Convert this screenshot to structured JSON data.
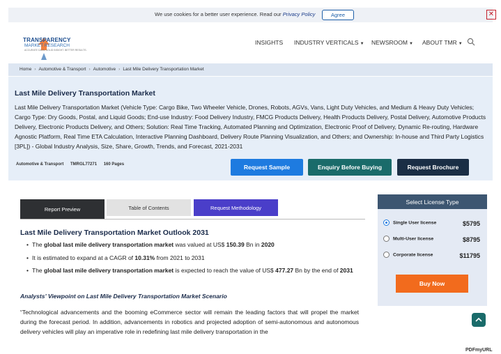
{
  "cookie": {
    "text": "We use cookies for a better user experience. Read our ",
    "link": "Privacy Policy",
    "agree": "Agree",
    "close": "✕"
  },
  "logo": {
    "main": "TRANSPARENCY",
    "sub": "MARKET RESEARCH",
    "tag": "ACCURATE DATA. SOLID INSIGHT. BETTER RESULTS."
  },
  "nav": [
    "INSIGHTS",
    "INDUSTRY VERTICALS",
    "NEWSROOM",
    "ABOUT TMR"
  ],
  "breadcrumb": [
    "Home",
    "Automotive & Transport",
    "Automotive",
    "Last Mile Delivery Transportation Market"
  ],
  "hero": {
    "title": "Last Mile Delivery Transportation Market",
    "description": "Last Mile Delivery Transportation Market (Vehicle Type: Cargo Bike, Two Wheeler Vehicle, Drones, Robots, AGVs, Vans, Light Duty Vehicles, and Medium & Heavy Duty Vehicles; Cargo Type: Dry Goods, Postal, and Liquid Goods; End-use Industry: Food Delivery Industry, FMCG Products Delivery, Health Products Delivery, Postal Delivery, Automotive Products Delivery, Electronic Products Delivery, and Others; Solution: Real Time Tracking, Automated Planning and Optimization, Electronic Proof of Delivery, Dynamic Re-routing, Hardware Agnostic Platform, Real Time ETA Calculation, Interactive Planning Dashboard, Delivery Route Planning Visualization, and Others; and Ownership: In-house and Third Party Logistics [3PL]) - Global Industry Analysis, Size, Share, Growth, Trends, and Forecast, 2021-2031",
    "category": "Automotive & Transport",
    "code": "TMRGL77271",
    "pages": "160 Pages",
    "btn_sample": "Request Sample",
    "btn_enquiry": "Enquiry Before Buying",
    "btn_brochure": "Request Brochure"
  },
  "tabs": [
    "Report Preview",
    "Table of Contents",
    "Request Methodology"
  ],
  "content": {
    "outlook_title": "Last Mile Delivery Transportation Market Outlook 2031",
    "b1_a": "The ",
    "b1_b": "global last mile delivery transportation market",
    "b1_c": " was valued at US$ ",
    "b1_d": "150.39",
    "b1_e": " Bn in ",
    "b1_f": "2020",
    "b2_a": "It is estimated to expand at a CAGR of ",
    "b2_b": "10.31%",
    "b2_c": " from 2021 to 2031",
    "b3_a": "The ",
    "b3_b": "global last mile delivery transportation market",
    "b3_c": " is expected to reach the value of US$ ",
    "b3_d": "477.27",
    "b3_e": " Bn by the end of ",
    "b3_f": "2031",
    "analyst": "Analysts’ Viewpoint on Last Mile Delivery Transportation Market Scenario",
    "quote": "“Technological advancements and the booming eCommerce sector will remain the leading factors that will propel the market during the forecast period. In addition, advancements in robotics and projected adoption of semi-autonomous and autonomous delivery vehicles will play an imperative role in redefining last mile delivery transportation in the"
  },
  "license": {
    "title": "Select License Type",
    "options": [
      {
        "label": "Single User license",
        "price": "$5795"
      },
      {
        "label": "Multi-User license",
        "price": "$8795"
      },
      {
        "label": "Corporate license",
        "price": "$11795"
      }
    ],
    "buy": "Buy Now"
  },
  "footer": {
    "pdfmyurl": "PDFmyURL"
  },
  "colors": {
    "primary_blue": "#1e7be0",
    "teal": "#1a6b6a",
    "navy": "#1a2e45",
    "orange": "#f26b1d",
    "purple": "#4a3ec9"
  }
}
